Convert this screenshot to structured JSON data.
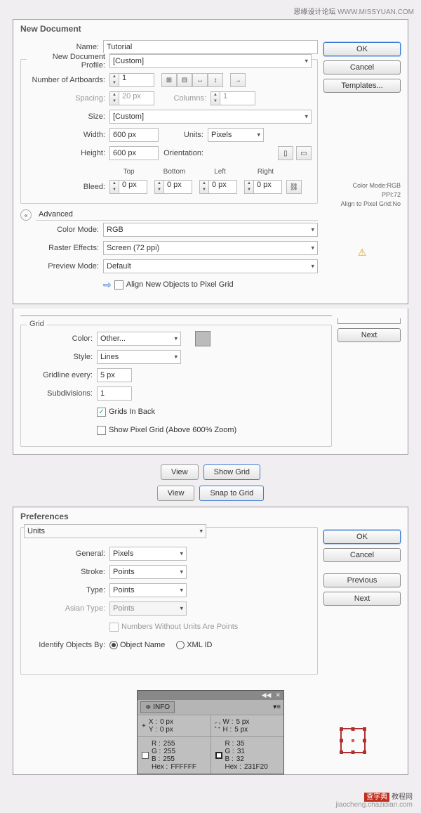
{
  "watermark_top": {
    "cn": "思缘设计论坛",
    "url": "WWW.MISSYUAN.COM"
  },
  "dialog1": {
    "title": "New Document",
    "buttons": {
      "ok": "OK",
      "cancel": "Cancel",
      "templates": "Templates..."
    },
    "info": {
      "l1": "Color Mode:RGB",
      "l2": "PPI:72",
      "l3": "Align to Pixel Grid:No"
    },
    "name_lbl": "Name:",
    "name_val": "Tutorial",
    "profile_lbl": "New Document Profile:",
    "profile_val": "[Custom]",
    "artboards_lbl": "Number of Artboards:",
    "artboards_val": "1",
    "spacing_lbl": "Spacing:",
    "spacing_val": "20 px",
    "columns_lbl": "Columns:",
    "columns_val": "1",
    "size_lbl": "Size:",
    "size_val": "[Custom]",
    "width_lbl": "Width:",
    "width_val": "600 px",
    "units_lbl": "Units:",
    "units_val": "Pixels",
    "height_lbl": "Height:",
    "height_val": "600 px",
    "orient_lbl": "Orientation:",
    "bleed_lbl": "Bleed:",
    "bleed_cols": {
      "top": "Top",
      "bottom": "Bottom",
      "left": "Left",
      "right": "Right"
    },
    "bleed_val": "0 px",
    "advanced": "Advanced",
    "color_mode_lbl": "Color Mode:",
    "color_mode_val": "RGB",
    "raster_lbl": "Raster Effects:",
    "raster_val": "Screen (72 ppi)",
    "preview_lbl": "Preview Mode:",
    "preview_val": "Default",
    "align_chk": "Align New Objects to Pixel Grid"
  },
  "grid": {
    "legend": "Grid",
    "next_btn": "Next",
    "color_lbl": "Color:",
    "color_val": "Other...",
    "style_lbl": "Style:",
    "style_val": "Lines",
    "every_lbl": "Gridline every:",
    "every_val": "5 px",
    "sub_lbl": "Subdivisions:",
    "sub_val": "1",
    "back_chk": "Grids In Back",
    "pixel_chk": "Show Pixel Grid (Above 600% Zoom)"
  },
  "menus": {
    "view1": "View",
    "show_grid": "Show Grid",
    "view2": "View",
    "snap_grid": "Snap to Grid"
  },
  "prefs": {
    "title": "Preferences",
    "tab": "Units",
    "buttons": {
      "ok": "OK",
      "cancel": "Cancel",
      "prev": "Previous",
      "next": "Next"
    },
    "general_lbl": "General:",
    "general_val": "Pixels",
    "stroke_lbl": "Stroke:",
    "stroke_val": "Points",
    "type_lbl": "Type:",
    "type_val": "Points",
    "asian_lbl": "Asian Type:",
    "asian_val": "Points",
    "numbers_chk": "Numbers Without Units Are Points",
    "identify_lbl": "Identify Objects By:",
    "obj_name": "Object Name",
    "xml_id": "XML ID"
  },
  "info": {
    "tab": "INFO",
    "x": "X :",
    "xv": "0 px",
    "y": "Y :",
    "yv": "0 px",
    "w": "W :",
    "wv": "5 px",
    "h": "H :",
    "hv": "5 px",
    "r1": "R :",
    "r1v": "255",
    "g1": "G :",
    "g1v": "255",
    "b1": "B :",
    "b1v": "255",
    "hex1l": "Hex :",
    "hex1": "FFFFFF",
    "r2": "R :",
    "r2v": "35",
    "g2": "G :",
    "g2v": "31",
    "b2": "B :",
    "b2v": "32",
    "hex2l": "Hex :",
    "hex2": "231F20"
  },
  "footer": {
    "brand": "查字典",
    "sub": "教程网",
    "url": "jiaocheng.chazidian.com"
  }
}
